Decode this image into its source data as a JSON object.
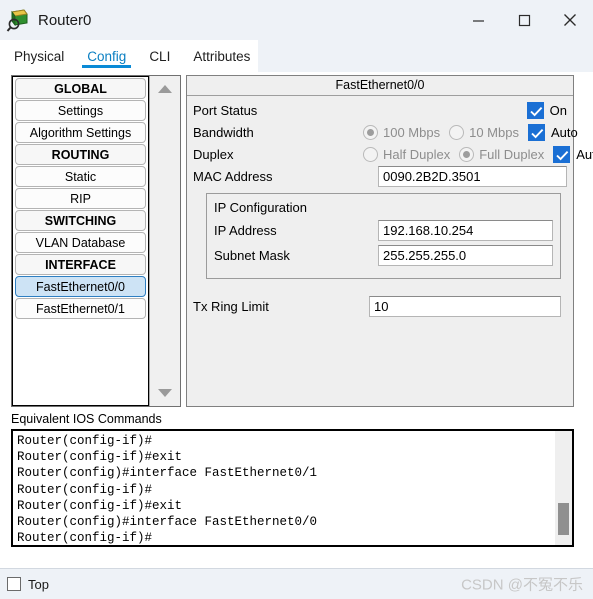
{
  "window": {
    "title": "Router0",
    "icon": "router-icon",
    "minimize_label": "—",
    "maximize_label": "□",
    "close_label": "✕"
  },
  "tabs": [
    {
      "label": "Physical",
      "active": false
    },
    {
      "label": "Config",
      "active": true
    },
    {
      "label": "CLI",
      "active": false
    },
    {
      "label": "Attributes",
      "active": false
    }
  ],
  "sidebar": {
    "items": [
      {
        "label": "GLOBAL",
        "type": "header"
      },
      {
        "label": "Settings",
        "type": "item"
      },
      {
        "label": "Algorithm Settings",
        "type": "item"
      },
      {
        "label": "ROUTING",
        "type": "header"
      },
      {
        "label": "Static",
        "type": "item"
      },
      {
        "label": "RIP",
        "type": "item"
      },
      {
        "label": "SWITCHING",
        "type": "header"
      },
      {
        "label": "VLAN Database",
        "type": "item"
      },
      {
        "label": "INTERFACE",
        "type": "header"
      },
      {
        "label": "FastEthernet0/0",
        "type": "item",
        "selected": true
      },
      {
        "label": "FastEthernet0/1",
        "type": "item"
      }
    ]
  },
  "panel": {
    "title": "FastEthernet0/0",
    "port_status": {
      "label": "Port Status",
      "checkbox_label": "On",
      "checked": true
    },
    "bandwidth": {
      "label": "Bandwidth",
      "option_100": "100 Mbps",
      "option_10": "10 Mbps",
      "selected": "100 Mbps",
      "auto_label": "Auto",
      "auto_checked": true
    },
    "duplex": {
      "label": "Duplex",
      "option_half": "Half Duplex",
      "option_full": "Full Duplex",
      "selected": "Full Duplex",
      "auto_label": "Auto",
      "auto_checked": true
    },
    "mac": {
      "label": "MAC Address",
      "value": "0090.2B2D.3501"
    },
    "ip_configuration": {
      "title": "IP Configuration",
      "ip_address_label": "IP Address",
      "ip_address_value": "192.168.10.254",
      "subnet_mask_label": "Subnet Mask",
      "subnet_mask_value": "255.255.255.0"
    },
    "tx_ring_limit": {
      "label": "Tx Ring Limit",
      "value": "10"
    }
  },
  "ios": {
    "label": "Equivalent IOS Commands",
    "lines": "Router(config-if)#\nRouter(config-if)#exit\nRouter(config)#interface FastEthernet0/1\nRouter(config-if)#\nRouter(config-if)#exit\nRouter(config)#interface FastEthernet0/0\nRouter(config-if)#"
  },
  "statusbar": {
    "top_label": "Top",
    "top_checked": false,
    "watermark": "CSDN @不冤不乐"
  },
  "colors": {
    "accent_blue": "#1a6fd4",
    "tab_active": "#0a8ad6",
    "selection_fill": "#cde3f5",
    "titlebar_bg": "#eef2f7"
  }
}
